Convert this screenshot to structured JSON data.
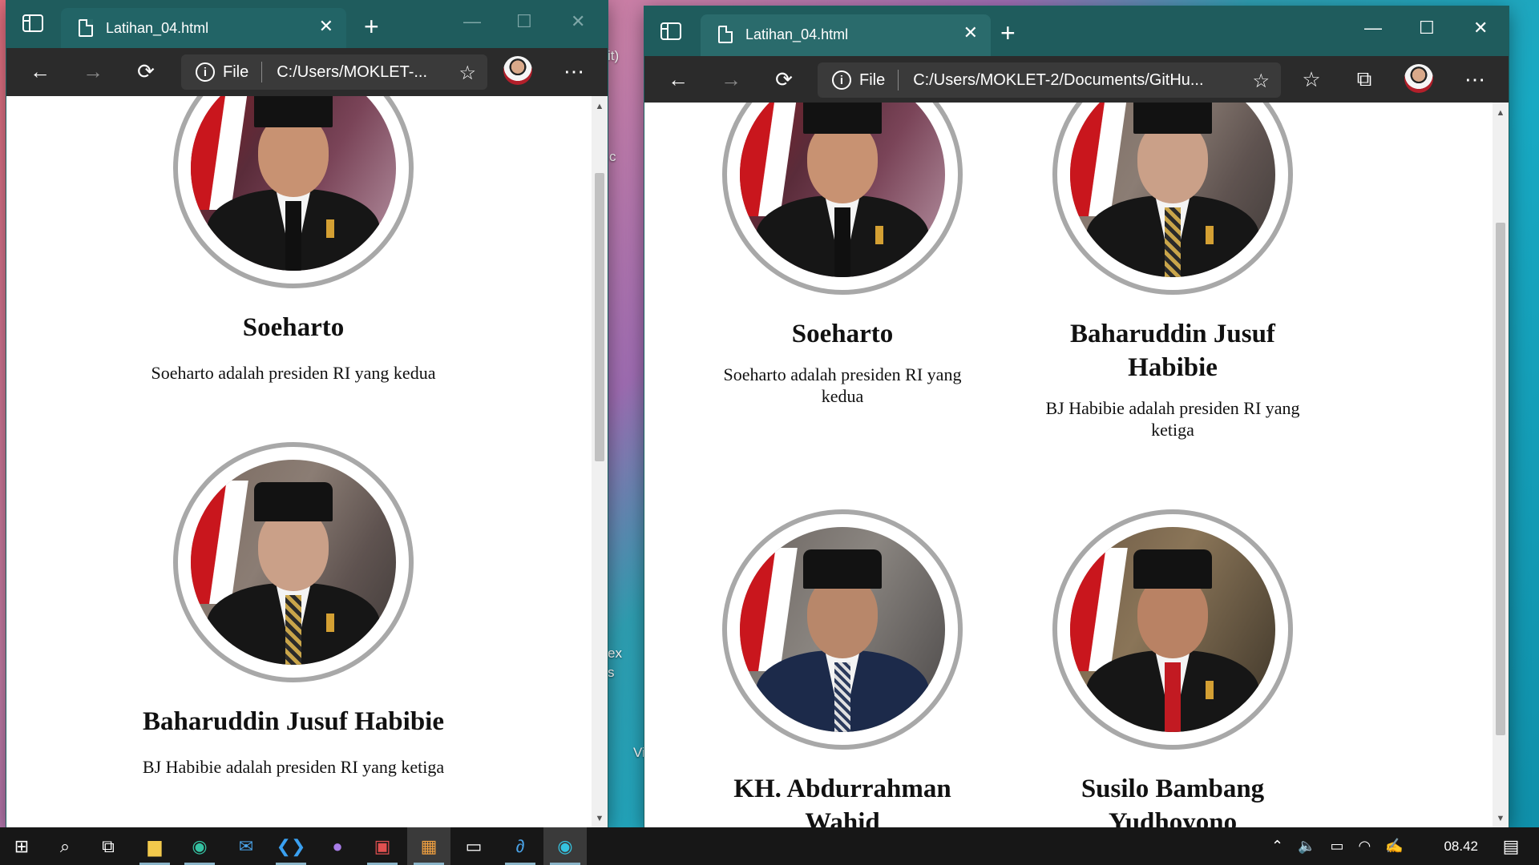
{
  "desktop": {
    "fragments": [
      "it)",
      "c",
      "ex",
      "s",
      "Vi"
    ]
  },
  "left_window": {
    "tab_title": "Latihan_04.html",
    "address": {
      "scheme_label": "File",
      "url": "C:/Users/MOKLET-..."
    }
  },
  "right_window": {
    "tab_title": "Latihan_04.html",
    "address": {
      "scheme_label": "File",
      "url": "C:/Users/MOKLET-2/Documents/GitHu..."
    }
  },
  "presidents": [
    {
      "name": "Soeharto",
      "desc": "Soeharto adalah presiden RI yang kedua"
    },
    {
      "name": "Baharuddin Jusuf Habibie",
      "desc": "BJ Habibie adalah presiden RI yang ketiga"
    },
    {
      "name": "KH. Abdurrahman Wahid",
      "desc": ""
    },
    {
      "name": "Susilo Bambang Yudhoyono",
      "desc": ""
    }
  ],
  "colors": {
    "browser_frame": "#1f5c5d",
    "toolbar": "#2b2b2b",
    "portrait_ring": "#a8a8a8"
  },
  "taskbar": {
    "clock": "08.42",
    "icons": [
      "windows-start-icon",
      "search-icon",
      "task-view-icon",
      "file-explorer-icon",
      "edge-icon",
      "mail-icon",
      "vscode-icon",
      "github-desktop-icon",
      "app-icon",
      "photo-app-icon",
      "terminal-icon",
      "editor-icon",
      "edge-icon"
    ]
  }
}
